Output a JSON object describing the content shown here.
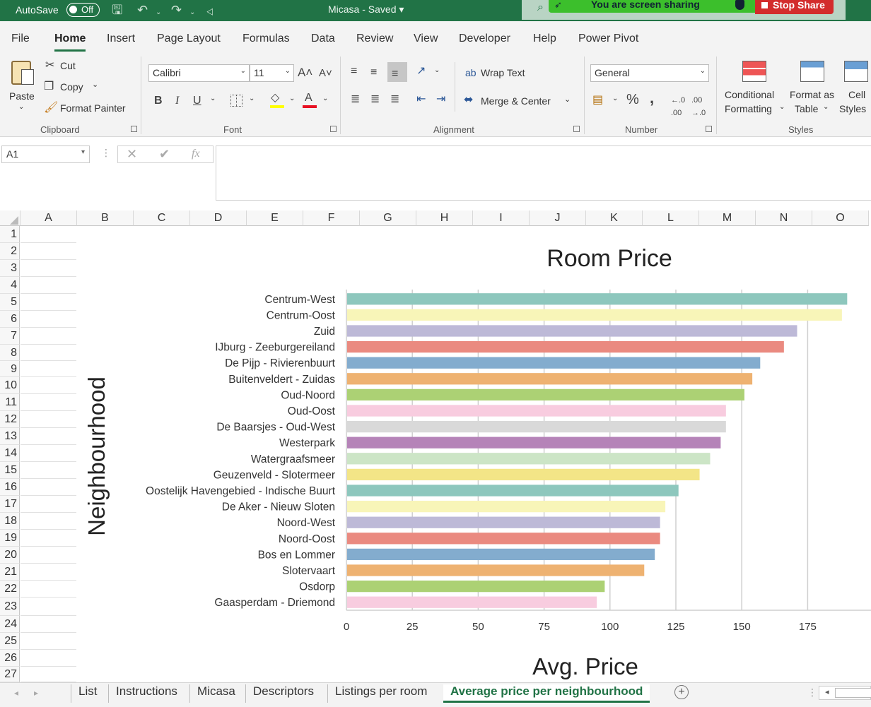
{
  "titlebar": {
    "autosave_label": "AutoSave",
    "autosave_state": "Off",
    "document_title": "Micasa  -  Saved",
    "sharing_text": "You are screen sharing",
    "stop_share_label": "Stop Share"
  },
  "menu": {
    "tabs": [
      "File",
      "Home",
      "Insert",
      "Page Layout",
      "Formulas",
      "Data",
      "Review",
      "View",
      "Developer",
      "Help",
      "Power Pivot"
    ],
    "active": "Home"
  },
  "ribbon": {
    "clipboard": {
      "paste": "Paste",
      "cut": "Cut",
      "copy": "Copy",
      "format_painter": "Format Painter",
      "label": "Clipboard"
    },
    "font": {
      "name": "Calibri",
      "size": "11",
      "bold": "B",
      "italic": "I",
      "underline": "U",
      "label": "Font",
      "highlight_color": "#ffff00",
      "font_color": "#e81123"
    },
    "alignment": {
      "wrap_text": "Wrap Text",
      "merge_center": "Merge & Center",
      "label": "Alignment"
    },
    "number": {
      "format": "General",
      "percent": "%",
      "comma": ",",
      "label": "Number"
    },
    "styles": {
      "conditional_line1": "Conditional",
      "conditional_line2": "Formatting",
      "format_table_line1": "Format as",
      "format_table_line2": "Table",
      "cell_styles_line1": "Cell",
      "cell_styles_line2": "Styles",
      "label": "Styles"
    }
  },
  "formula_bar": {
    "name_box": "A1",
    "fx": "fx",
    "value": ""
  },
  "columns": [
    "A",
    "B",
    "C",
    "D",
    "E",
    "F",
    "G",
    "H",
    "I",
    "J",
    "K",
    "L",
    "M",
    "N",
    "O"
  ],
  "rows": [
    "1",
    "2",
    "3",
    "4",
    "5",
    "6",
    "7",
    "8",
    "9",
    "10",
    "11",
    "12",
    "13",
    "14",
    "15",
    "16",
    "17",
    "18",
    "19",
    "20",
    "21",
    "22",
    "23",
    "24",
    "25",
    "26",
    "27"
  ],
  "chart_data": {
    "type": "bar",
    "orientation": "horizontal",
    "title": "Room Price",
    "xlabel": "Avg. Price",
    "ylabel": "Neighbourhood",
    "xlim": [
      0,
      190
    ],
    "xticks": [
      0,
      25,
      50,
      75,
      100,
      125,
      150,
      175
    ],
    "grid": "vertical",
    "categories": [
      "Centrum-West",
      "Centrum-Oost",
      "Zuid",
      "IJburg - Zeeburgereiland",
      "De Pijp - Rivierenbuurt",
      "Buitenveldert - Zuidas",
      "Oud-Noord",
      "Oud-Oost",
      "De Baarsjes - Oud-West",
      "Westerpark",
      "Watergraafsmeer",
      "Geuzenveld - Slotermeer",
      "Oostelijk Havengebied - Indische Buurt",
      "De Aker - Nieuw Sloten",
      "Noord-West",
      "Noord-Oost",
      "Bos en Lommer",
      "Slotervaart",
      "Osdorp",
      "Gaasperdam - Driemond"
    ],
    "values": [
      190,
      188,
      171,
      166,
      157,
      154,
      151,
      144,
      144,
      142,
      138,
      134,
      126,
      121,
      119,
      119,
      117,
      113,
      98,
      95
    ],
    "colors": [
      "#8dc7bd",
      "#f8f5b8",
      "#bdb9d7",
      "#ea8a80",
      "#83acce",
      "#eeb271",
      "#acd174",
      "#f8ccdf",
      "#d9d9d9",
      "#b583b8",
      "#cce5c6",
      "#f3e587",
      "#8dc7bd",
      "#f8f5b8",
      "#bdb9d7",
      "#ea8a80",
      "#83acce",
      "#eeb271",
      "#acd174",
      "#f8ccdf"
    ]
  },
  "sheet_tabs": [
    "List",
    "Instructions",
    "Micasa",
    "Descriptors",
    "Listings per room",
    "Average price per neighbourhood"
  ],
  "active_sheet": "Average price per neighbourhood",
  "colors": {
    "brand_green": "#217346",
    "share_green": "#3cbf2c",
    "stop_red": "#d32c2c"
  }
}
